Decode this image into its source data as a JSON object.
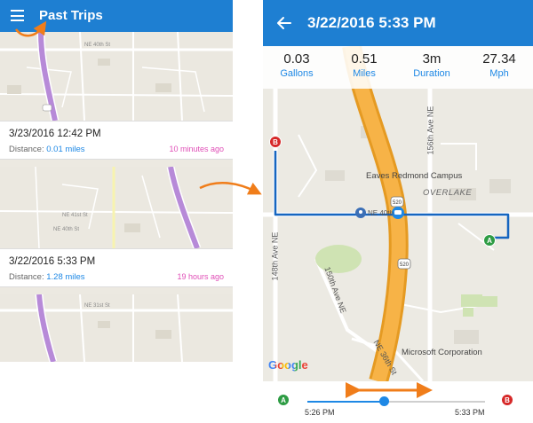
{
  "list_screen": {
    "title": "Past Trips",
    "trips": [
      {
        "date": "3/23/2016 12:42 PM",
        "distance_label": "Distance:",
        "distance_value": "0.01 miles",
        "ago": "10 minutes ago"
      },
      {
        "date": "3/22/2016 5:33 PM",
        "distance_label": "Distance:",
        "distance_value": "1.28 miles",
        "ago": "19 hours ago"
      }
    ],
    "map_labels": [
      "NE 40th St",
      "NE 41st St",
      "NE 40th St",
      "NE 31st St"
    ]
  },
  "detail_screen": {
    "title": "3/22/2016 5:33 PM",
    "stats": [
      {
        "value": "0.03",
        "label": "Gallons"
      },
      {
        "value": "0.51",
        "label": "Miles"
      },
      {
        "value": "3m",
        "label": "Duration"
      },
      {
        "value": "27.34",
        "label": "Mph"
      }
    ],
    "map": {
      "poi_1": "Eaves Redmond Campus",
      "area": "OVERLAKE",
      "poi_2": "Microsoft Corporation",
      "street_148": "148th Ave NE",
      "street_156": "156th Ave NE",
      "street_150": "150th Ave NE",
      "street_ne36": "NE 36th St",
      "street_ne40": "NE 40th",
      "route_shield_1": "520",
      "route_shield_2": "520",
      "attribution": "Google",
      "start_marker": "A",
      "end_marker": "B"
    },
    "timeline": {
      "start_marker": "A",
      "end_marker": "B",
      "start_time": "5:26 PM",
      "end_time": "5:33 PM",
      "position": 0.43
    }
  },
  "colors": {
    "appbar": "#1e7fd2",
    "accent_blue": "#1e88e5",
    "ago_pink": "#e04fb7",
    "highway_orange": "#f5a623",
    "route_blue": "#1565c0",
    "annotation_orange": "#f07d1a"
  }
}
